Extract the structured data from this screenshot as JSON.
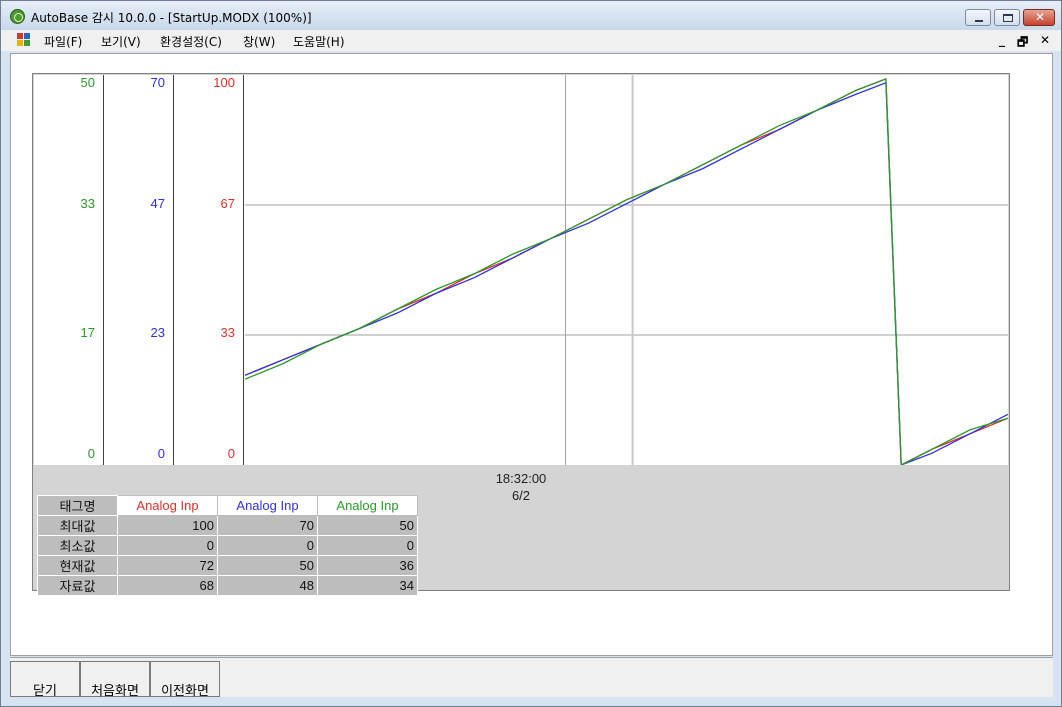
{
  "window": {
    "title": "AutoBase 감시 10.0.0 - [StartUp.MODX (100%)]"
  },
  "menu": {
    "items": [
      "파일(F)",
      "보기(V)",
      "환경설정(C)",
      "창(W)",
      "도움말(H)"
    ],
    "mdi_minimize": "_",
    "mdi_restore": "🗗",
    "mdi_close": "✕"
  },
  "colors": {
    "series1": "#e0302a",
    "series2": "#3030e0",
    "series3": "#2a9a2a"
  },
  "trend": {
    "axes": [
      {
        "color": "#2a9a2a",
        "ticks": [
          "50",
          "33",
          "17",
          "0"
        ]
      },
      {
        "color": "#3030e0",
        "ticks": [
          "70",
          "47",
          "23",
          "0"
        ]
      },
      {
        "color": "#e0302a",
        "ticks": [
          "100",
          "67",
          "33",
          "0"
        ]
      }
    ],
    "time_label": "18:32:00",
    "date_label": "6/2"
  },
  "chart_data": {
    "type": "line",
    "ylim": [
      0,
      100
    ],
    "grid": true,
    "x": [
      0,
      0.05,
      0.1,
      0.15,
      0.2,
      0.25,
      0.3,
      0.35,
      0.4,
      0.45,
      0.5,
      0.55,
      0.6,
      0.65,
      0.7,
      0.75,
      0.8,
      0.84,
      0.86,
      0.9,
      0.95,
      1.0
    ],
    "series": [
      {
        "name": "Analog Inp",
        "color": "#e0302a",
        "values": [
          23,
          27,
          31,
          35,
          40,
          44,
          49,
          53,
          58,
          63,
          68,
          72,
          77,
          82,
          86,
          91,
          96,
          99,
          0,
          4,
          8,
          12
        ]
      },
      {
        "name": "Analog Inp",
        "color": "#3030e0",
        "values": [
          23,
          27,
          31,
          35,
          39,
          44,
          48,
          53,
          58,
          62,
          67,
          72,
          76,
          81,
          86,
          91,
          95,
          98,
          0,
          3,
          8,
          13
        ]
      },
      {
        "name": "Analog Inp",
        "color": "#2a9a2a",
        "values": [
          22,
          26,
          31,
          35,
          40,
          45,
          49,
          54,
          58,
          63,
          68,
          72,
          77,
          82,
          87,
          91,
          96,
          99,
          0,
          4,
          9,
          12
        ]
      }
    ]
  },
  "legend": {
    "header": "태그명",
    "columns": [
      {
        "label": "Analog Inp",
        "color": "#e0302a"
      },
      {
        "label": "Analog Inp",
        "color": "#3030e0"
      },
      {
        "label": "Analog Inp",
        "color": "#2a9a2a"
      }
    ],
    "rows": [
      {
        "label": "최대값",
        "values": [
          "100",
          "70",
          "50"
        ]
      },
      {
        "label": "최소값",
        "values": [
          "0",
          "0",
          "0"
        ]
      },
      {
        "label": "현재값",
        "values": [
          "72",
          "50",
          "36"
        ]
      },
      {
        "label": "자료값",
        "values": [
          "68",
          "48",
          "34"
        ]
      }
    ]
  },
  "footer": {
    "buttons": [
      "닫기",
      "처음화면",
      "이전화면"
    ]
  }
}
